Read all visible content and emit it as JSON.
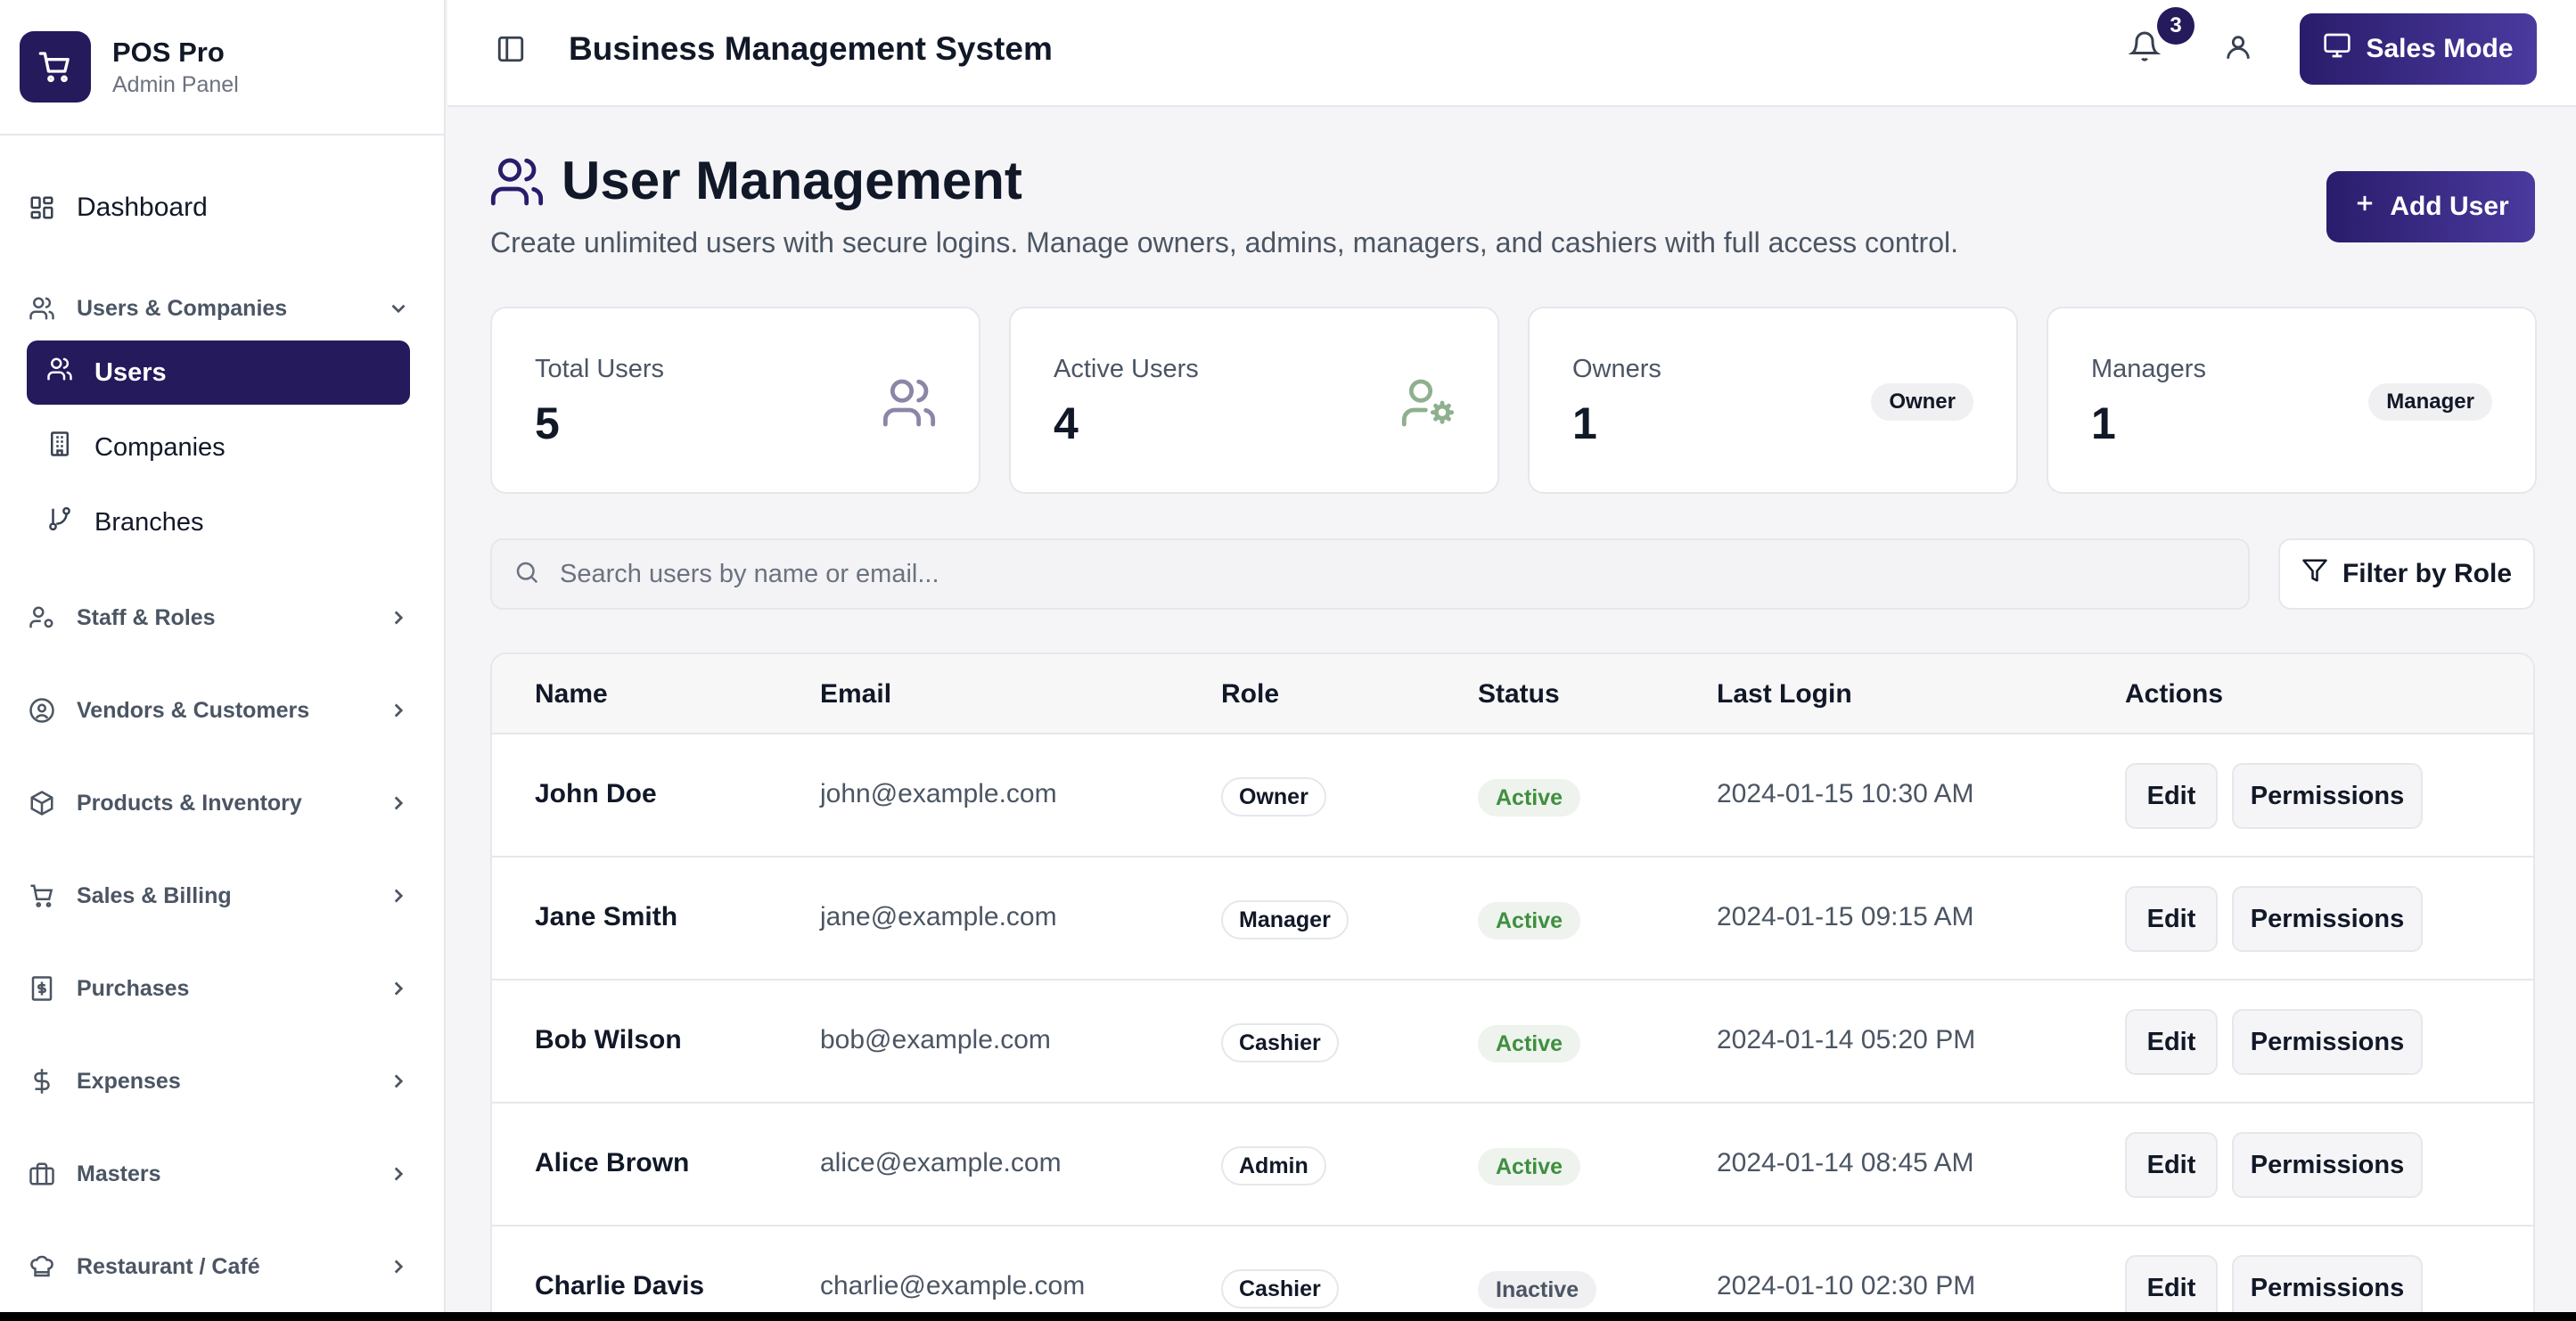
{
  "brand": {
    "name": "POS Pro",
    "subtitle": "Admin Panel"
  },
  "sidebar": {
    "dashboard": "Dashboard",
    "users_companies": "Users & Companies",
    "users": "Users",
    "companies": "Companies",
    "branches": "Branches",
    "staff_roles": "Staff & Roles",
    "vendors_customers": "Vendors & Customers",
    "products_inventory": "Products & Inventory",
    "sales_billing": "Sales & Billing",
    "purchases": "Purchases",
    "expenses": "Expenses",
    "masters": "Masters",
    "restaurant_cafe": "Restaurant / Café"
  },
  "header": {
    "title": "Business Management System",
    "notification_count": "3",
    "sales_mode": "Sales Mode"
  },
  "page": {
    "title": "User Management",
    "subtitle": "Create unlimited users with secure logins. Manage owners, admins, managers, and cashiers with full access control.",
    "add_user": "Add User"
  },
  "stats": {
    "total": {
      "label": "Total Users",
      "value": "5"
    },
    "active": {
      "label": "Active Users",
      "value": "4"
    },
    "owners": {
      "label": "Owners",
      "value": "1",
      "pill": "Owner"
    },
    "managers": {
      "label": "Managers",
      "value": "1",
      "pill": "Manager"
    }
  },
  "search": {
    "placeholder": "Search users by name or email...",
    "filter": "Filter by Role"
  },
  "table": {
    "headers": {
      "name": "Name",
      "email": "Email",
      "role": "Role",
      "status": "Status",
      "last_login": "Last Login",
      "actions": "Actions"
    },
    "edit_label": "Edit",
    "permissions_label": "Permissions",
    "rows": [
      {
        "name": "John Doe",
        "email": "john@example.com",
        "role": "Owner",
        "status": "Active",
        "last_login": "2024-01-15 10:30 AM"
      },
      {
        "name": "Jane Smith",
        "email": "jane@example.com",
        "role": "Manager",
        "status": "Active",
        "last_login": "2024-01-15 09:15 AM"
      },
      {
        "name": "Bob Wilson",
        "email": "bob@example.com",
        "role": "Cashier",
        "status": "Active",
        "last_login": "2024-01-14 05:20 PM"
      },
      {
        "name": "Alice Brown",
        "email": "alice@example.com",
        "role": "Admin",
        "status": "Active",
        "last_login": "2024-01-14 08:45 AM"
      },
      {
        "name": "Charlie Davis",
        "email": "charlie@example.com",
        "role": "Cashier",
        "status": "Inactive",
        "last_login": "2024-01-10 02:30 PM"
      }
    ]
  },
  "colors": {
    "brand": "#251a5c",
    "active_status": "#3f8f3f"
  }
}
